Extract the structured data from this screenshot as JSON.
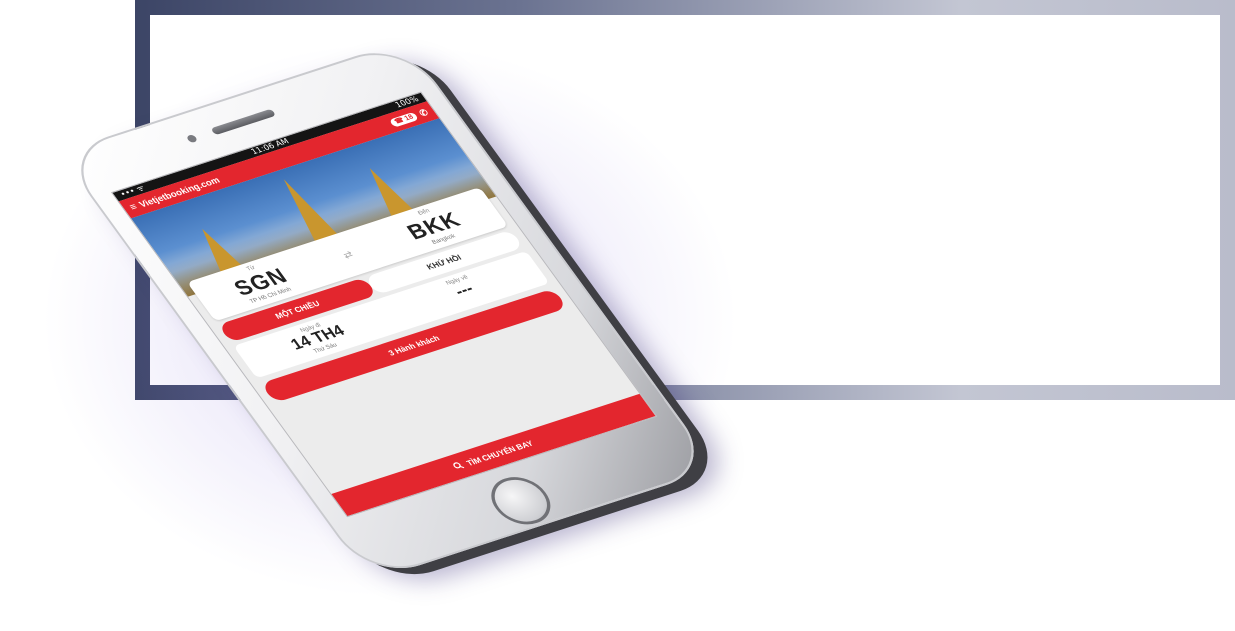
{
  "status_bar": {
    "left": "••• ᯤ",
    "time": "11:06 AM",
    "battery": "100%"
  },
  "app_bar": {
    "menu_icon": "≡",
    "site": "Vietjetbooking.com",
    "badge": "☎ 18",
    "phone_icon": "✆"
  },
  "route": {
    "from_label": "Từ",
    "from_code": "SGN",
    "from_city": "TP Hồ Chí Minh",
    "to_label": "Đến",
    "to_code": "BKK",
    "to_city": "Bangkok",
    "swap_icon": "⇄"
  },
  "trip_type": {
    "one_way": "MỘT CHIỀU",
    "round_trip": "KHỨ HỒI"
  },
  "dates": {
    "depart_label": "Ngày đi",
    "depart_value": "14 TH4",
    "depart_weekday": "Thứ Sáu",
    "return_label": "Ngày về",
    "return_value": "---"
  },
  "passengers": "3 Hành khách",
  "search": {
    "icon": "search-icon",
    "label": "TÌM CHUYẾN BAY"
  },
  "colors": {
    "brand_red": "#e3262e"
  }
}
